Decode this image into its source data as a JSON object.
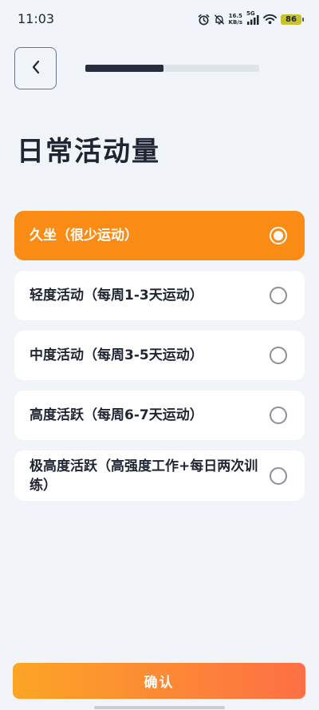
{
  "status_bar": {
    "time": "11:03",
    "net_speed_value": "16.5",
    "net_speed_unit": "KB/s",
    "network_type": "5G",
    "battery": "86",
    "battery_color": "#c8c22c"
  },
  "header": {
    "progress": 0.45
  },
  "page": {
    "title": "日常活动量"
  },
  "options": [
    {
      "label": "久坐（很少运动）",
      "selected": true
    },
    {
      "label": "轻度活动（每周1-3天运动）",
      "selected": false
    },
    {
      "label": "中度活动（每周3-5天运动）",
      "selected": false
    },
    {
      "label": "高度活跃（每周6-7天运动）",
      "selected": false
    },
    {
      "label": "极高度活跃（高强度工作+每日两次训练）",
      "selected": false
    }
  ],
  "confirm_label": "确认",
  "colors": {
    "accent": "#fa8c16",
    "background": "#f1f4f9",
    "button_gradient_start": "#fca524",
    "button_gradient_end": "#fd7045"
  },
  "icons": {
    "back": "chevron-left-icon",
    "alarm": "alarm-icon",
    "mute": "bell-off-icon",
    "signal": "signal-icon",
    "wifi": "wifi-icon",
    "battery": "battery-icon"
  }
}
